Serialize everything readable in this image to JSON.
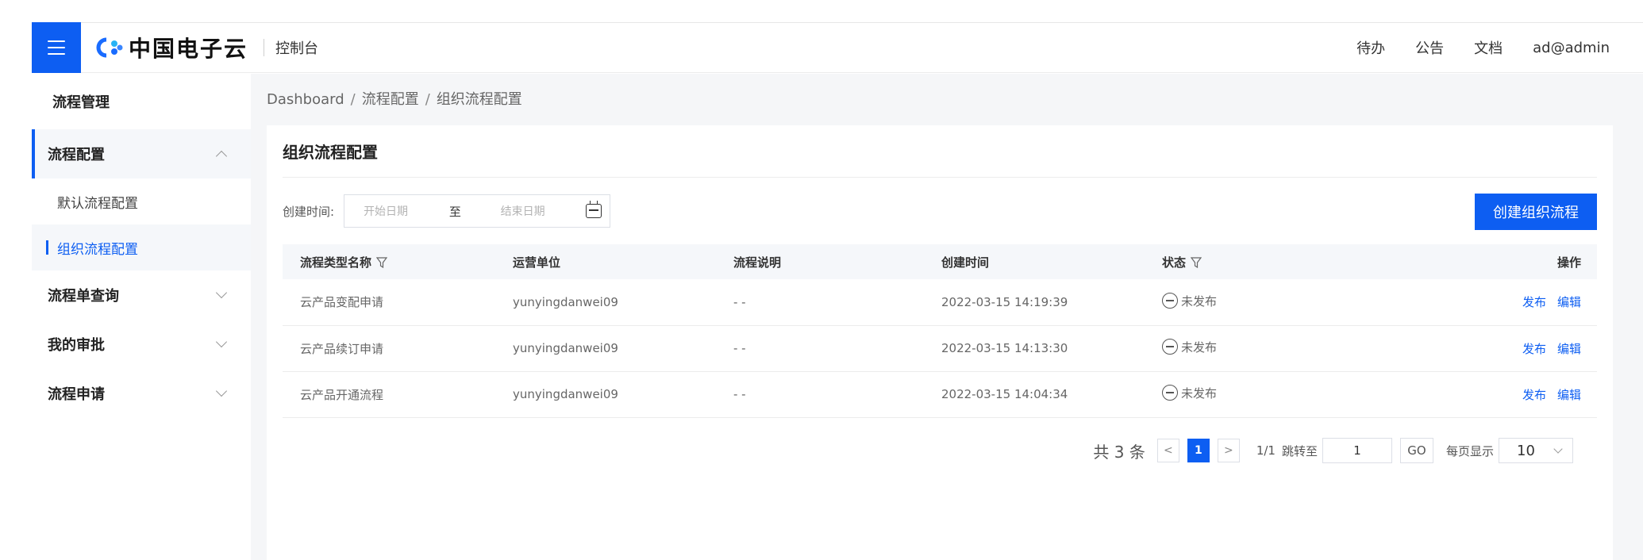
{
  "header": {
    "logo_text": "中国电子云",
    "console": "控制台",
    "nav": [
      "待办",
      "公告",
      "文档",
      "ad@admin"
    ]
  },
  "sidebar": {
    "title": "流程管理",
    "items": [
      {
        "label": "流程配置",
        "expanded": true,
        "children": [
          "默认流程配置",
          "组织流程配置"
        ]
      },
      {
        "label": "流程单查询"
      },
      {
        "label": "我的审批"
      },
      {
        "label": "流程申请"
      }
    ]
  },
  "breadcrumb": [
    "Dashboard",
    "流程配置",
    "组织流程配置"
  ],
  "page": {
    "title": "组织流程配置",
    "filter_label": "创建时间:",
    "start_placeholder": "开始日期",
    "to": "至",
    "end_placeholder": "结束日期",
    "create_button": "创建组织流程"
  },
  "table": {
    "columns": [
      "流程类型名称",
      "运营单位",
      "流程说明",
      "创建时间",
      "状态",
      "操作"
    ],
    "rows": [
      {
        "name": "云产品变配申请",
        "unit": "yunyingdanwei09",
        "desc": "- -",
        "time": "2022-03-15 14:19:39",
        "status": "未发布"
      },
      {
        "name": "云产品续订申请",
        "unit": "yunyingdanwei09",
        "desc": "- -",
        "time": "2022-03-15 14:13:30",
        "status": "未发布"
      },
      {
        "name": "云产品开通流程",
        "unit": "yunyingdanwei09",
        "desc": "- -",
        "time": "2022-03-15 14:04:34",
        "status": "未发布"
      }
    ],
    "actions": [
      "发布",
      "编辑"
    ]
  },
  "pagination": {
    "total": "共 3 条",
    "prev": "<",
    "current": "1",
    "next": ">",
    "info": "1/1",
    "jump_label": "跳转至",
    "jump_value": "1",
    "go": "GO",
    "per_page_label": "每页显示",
    "per_page": "10"
  },
  "colors": {
    "primary": "#0d5ef2"
  }
}
